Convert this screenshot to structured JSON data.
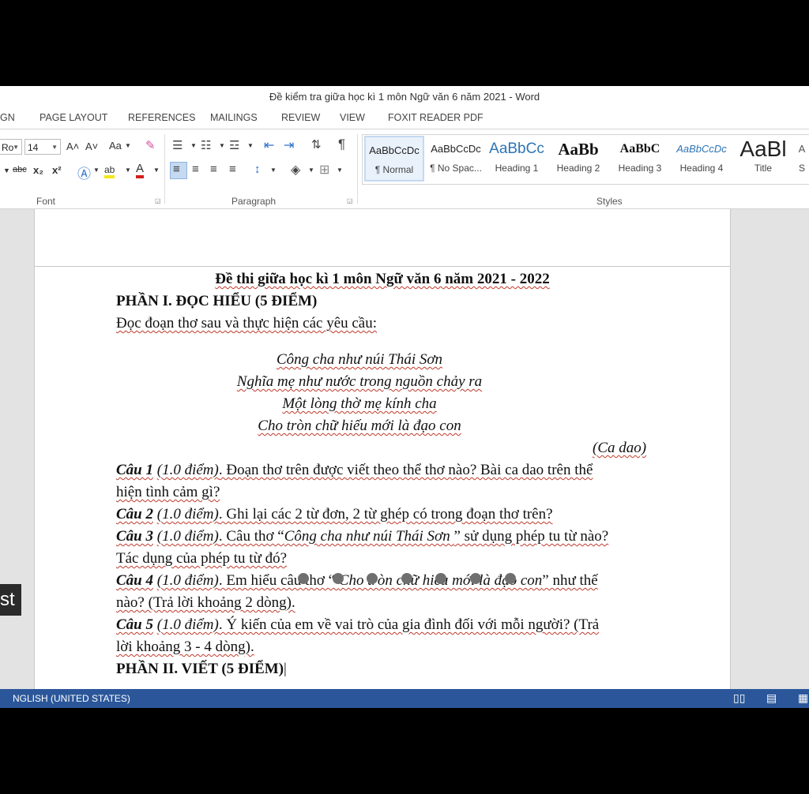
{
  "window": {
    "title": "Đề kiểm tra giữa học kì 1 môn Ngữ văn 6 năm 2021 - Word"
  },
  "tabs": [
    "GN",
    "PAGE LAYOUT",
    "REFERENCES",
    "MAILINGS",
    "REVIEW",
    "VIEW",
    "FOXIT READER PDF"
  ],
  "ribbon": {
    "font_name": "Ro",
    "font_size": "14",
    "case_label": "Aa",
    "grow_font": "A˄",
    "shrink_font": "A˅",
    "strike_label": "abc",
    "sub_label": "x₂",
    "sup_label": "x²",
    "font_group": "Font",
    "paragraph_group": "Paragraph",
    "styles_group": "Styles",
    "styles": [
      {
        "preview": "AaBbCcDc",
        "name": "¶ Normal"
      },
      {
        "preview": "AaBbCcDc",
        "name": "¶ No Spac..."
      },
      {
        "preview": "AaBbCc",
        "name": "Heading 1"
      },
      {
        "preview": "AaBb",
        "name": "Heading 2"
      },
      {
        "preview": "AaBbC",
        "name": "Heading 3"
      },
      {
        "preview": "AaBbCcDc",
        "name": "Heading 4"
      },
      {
        "preview": "AaBl",
        "name": "Title"
      },
      {
        "preview": "A",
        "name": "S"
      }
    ]
  },
  "doc": {
    "title": "Đề thi giữa học kì 1 môn Ngữ văn 6 năm 2021 - 2022",
    "part1": "PHẦN I. ĐỌC HIỂU (5 ĐIỂM)",
    "instruction": "Đọc đoạn thơ sau và thực hiện các yêu cầu:",
    "poem": [
      "Công cha như núi Thái Sơn",
      "Nghĩa mẹ như nước trong nguồn chảy ra",
      "Một lòng thờ mẹ kính cha",
      "Cho tròn chữ hiếu mới là đạo con"
    ],
    "source": "(Ca dao)",
    "q1_label": "Câu 1",
    "q1_score": "(1.0 điểm)",
    "q1_text": ". Đoạn thơ trên được viết theo thể thơ nào? Bài ca dao trên thể",
    "q1_text2": "hiện tình cảm gì?",
    "q2_label": "Câu 2",
    "q2_score": "(1.0 điểm)",
    "q2_text": ". Ghi lại các 2 từ đơn, 2 từ ghép có trong đoạn thơ trên?",
    "q3_label": "Câu 3",
    "q3_score": "(1.0 điểm)",
    "q3_text_a": ". Câu thơ “",
    "q3_quote": "Công cha như núi Thái Sơn ",
    "q3_text_b": "” sử dụng phép tu từ nào?",
    "q3_text2": "Tác dụng của phép tu từ đó?",
    "q4_label": "Câu 4",
    "q4_score": "(1.0 điểm)",
    "q4_text_a": ". Em hiểu câu thơ “ ",
    "q4_quote": "Cho tròn chữ hiếu mới là đạo con",
    "q4_text_b": "” như thế",
    "q4_text2": "nào? (Trả lời khoảng 2 dòng).",
    "q5_label": "Câu 5",
    "q5_score": "(1.0 điểm)",
    "q5_text": ". Ý kiến của em về vai trò của gia đình đối với mỗi người? (Trả",
    "q5_text2": "lời khoảng 3 - 4 dòng).",
    "part2": "PHẦN II. VIẾT (5 ĐIỂM)"
  },
  "status": {
    "language": "NGLISH (UNITED STATES)"
  },
  "overlay": {
    "text": "st"
  }
}
